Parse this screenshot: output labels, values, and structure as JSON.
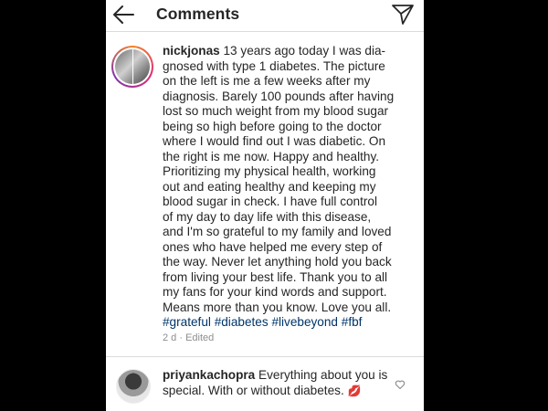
{
  "header": {
    "title": "Comments",
    "back_icon": "back-arrow-icon",
    "send_icon": "direct-send-icon"
  },
  "caption": {
    "username": "nickjonas",
    "lines": [
      "13 years ago today I was dia-",
      "gnosed with type 1 diabetes. The picture",
      "on the left is me a few weeks after my",
      "diagnosis. Barely 100 pounds after having",
      "lost so much weight from my blood sugar",
      "being so high before going to the doctor",
      "where I would find out I was diabetic. On",
      "the right is me now. Happy and healthy.",
      "Prioritizing my physical health, working",
      "out and eating healthy and keeping my",
      "blood sugar in check. I have full control",
      "of my day to day life with this disease,",
      "and I'm so grateful to my family and loved",
      "ones who have helped me every step of",
      "the way. Never let anything hold you back",
      "from living your best life. Thank you to all",
      "my fans for your kind words and support.",
      "Means more than you know. Love you all."
    ],
    "hashtags": [
      "#grateful",
      "#diabetes",
      "#livebeyond",
      "#fbf"
    ],
    "time": "2 d",
    "separator": "·",
    "edited_label": "Edited"
  },
  "comment": {
    "username": "priyankachopra",
    "text_line1": "Everything about you is",
    "text_line2": "special. With or without diabetes.",
    "emoji": "💋",
    "like_icon": "heart-outline-icon"
  },
  "colors": {
    "background": "#000000",
    "surface": "#ffffff",
    "text": "#262626",
    "hashtag": "#003569",
    "meta": "#8e8e8e"
  }
}
